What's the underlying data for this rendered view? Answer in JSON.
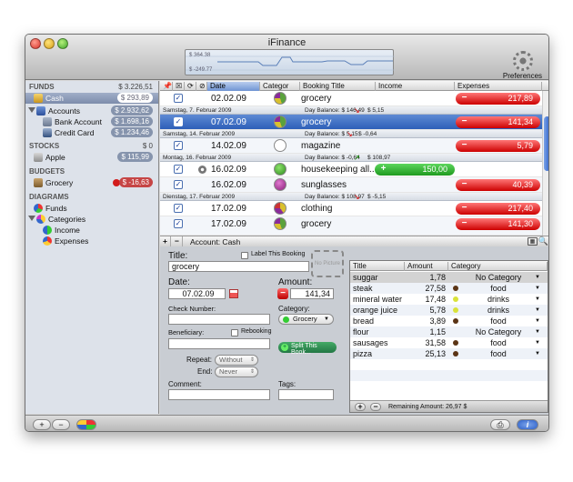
{
  "window": {
    "title": "iFinance"
  },
  "spark": {
    "max": "$ 364.38",
    "min": "$ -249.77"
  },
  "toolbar": {
    "prefs_label": "Preferences"
  },
  "sidebar": {
    "funds": {
      "header": "FUNDS",
      "total": "$ 3.226,51",
      "items": [
        {
          "label": "Cash",
          "value": "$ 293,89"
        },
        {
          "label": "Accounts",
          "value": "$ 2.932,62"
        },
        {
          "label": "Bank Account",
          "value": "$ 1.698,16"
        },
        {
          "label": "Credit Card",
          "value": "$ 1.234,46"
        }
      ]
    },
    "stocks": {
      "header": "STOCKS",
      "total": "$ 0",
      "items": [
        {
          "label": "Apple",
          "value": "$ 115,99"
        }
      ]
    },
    "budgets": {
      "header": "BUDGETS",
      "items": [
        {
          "label": "Grocery",
          "value": "$ -16,63"
        }
      ]
    },
    "diagrams": {
      "header": "DIAGRAMS",
      "items": [
        {
          "label": "Funds"
        },
        {
          "label": "Categories"
        },
        {
          "label": "Income"
        },
        {
          "label": "Expenses"
        }
      ]
    }
  },
  "table": {
    "columns": {
      "date": "Date",
      "category": "Categor",
      "title": "Booking Title",
      "income": "Income",
      "expenses": "Expenses"
    },
    "groups": [
      {
        "header": "Samstag, 7. Februar 2009",
        "balance_label": "Day Balance:",
        "balance": "$ 146,49",
        "change": "$ 5,15"
      },
      {
        "header": "Samstag, 14. Februar 2009",
        "balance_label": "Day Balance:",
        "balance": "$ 5,15",
        "change": "$ -0,64"
      },
      {
        "header": "Montag, 16. Februar 2009",
        "balance_label": "Day Balance:",
        "balance": "$ -0,64",
        "change": "$ 108,97"
      },
      {
        "header": "Dienstag, 17. Februar 2009",
        "balance_label": "Day Balance:",
        "balance": "$ 108,97",
        "change": "$ -5,15"
      }
    ],
    "rows": [
      {
        "date": "02.02.09",
        "title": "grocery",
        "amount": "217,89"
      },
      {
        "date": "07.02.09",
        "title": "grocery",
        "amount": "141,34"
      },
      {
        "date": "14.02.09",
        "title": "magazine",
        "amount": "5,79"
      },
      {
        "date": "16.02.09",
        "title": "housekeeping all...",
        "amount": "150,00"
      },
      {
        "date": "16.02.09",
        "title": "sunglasses",
        "amount": "40,39"
      },
      {
        "date": "17.02.09",
        "title": "clothing",
        "amount": "217,40"
      },
      {
        "date": "17.02.09",
        "title": "grocery",
        "amount": "141,30"
      }
    ],
    "footer_label": "Account: Cash"
  },
  "detail": {
    "title_label": "Title:",
    "title_value": "grocery",
    "label_booking": "Label This Booking",
    "picture": "No Picture",
    "date_label": "Date:",
    "date_value": "07.02.09",
    "amount_label": "Amount:",
    "amount_value": "141,34",
    "check_label": "Check Number:",
    "category_label": "Category:",
    "category_value": "Grocery",
    "beneficiary_label": "Beneficiary:",
    "rebooking": "Rebooking",
    "split_label": "Split This Book...",
    "repeat_label": "Repeat:",
    "repeat_value": "Without",
    "end_label": "End:",
    "end_value": "Never",
    "comment_label": "Comment:",
    "tags_label": "Tags:"
  },
  "items": {
    "columns": {
      "title": "Title",
      "amount": "Amount",
      "category": "Category"
    },
    "rows": [
      {
        "title": "suggar",
        "amount": "1,78",
        "category": "No Category"
      },
      {
        "title": "steak",
        "amount": "27,58",
        "category": "food"
      },
      {
        "title": "mineral water",
        "amount": "17,48",
        "category": "drinks"
      },
      {
        "title": "orange juice",
        "amount": "5,78",
        "category": "drinks"
      },
      {
        "title": "bread",
        "amount": "3,89",
        "category": "food"
      },
      {
        "title": "flour",
        "amount": "1,15",
        "category": "No Category"
      },
      {
        "title": "sausages",
        "amount": "31,58",
        "category": "food"
      },
      {
        "title": "pizza",
        "amount": "25,13",
        "category": "food"
      }
    ],
    "remaining": "Remaining Amount: 26,97 $"
  },
  "colors": {
    "accent": "#2d5fb8",
    "expense": "#d00000",
    "income": "#1f9a1f"
  }
}
